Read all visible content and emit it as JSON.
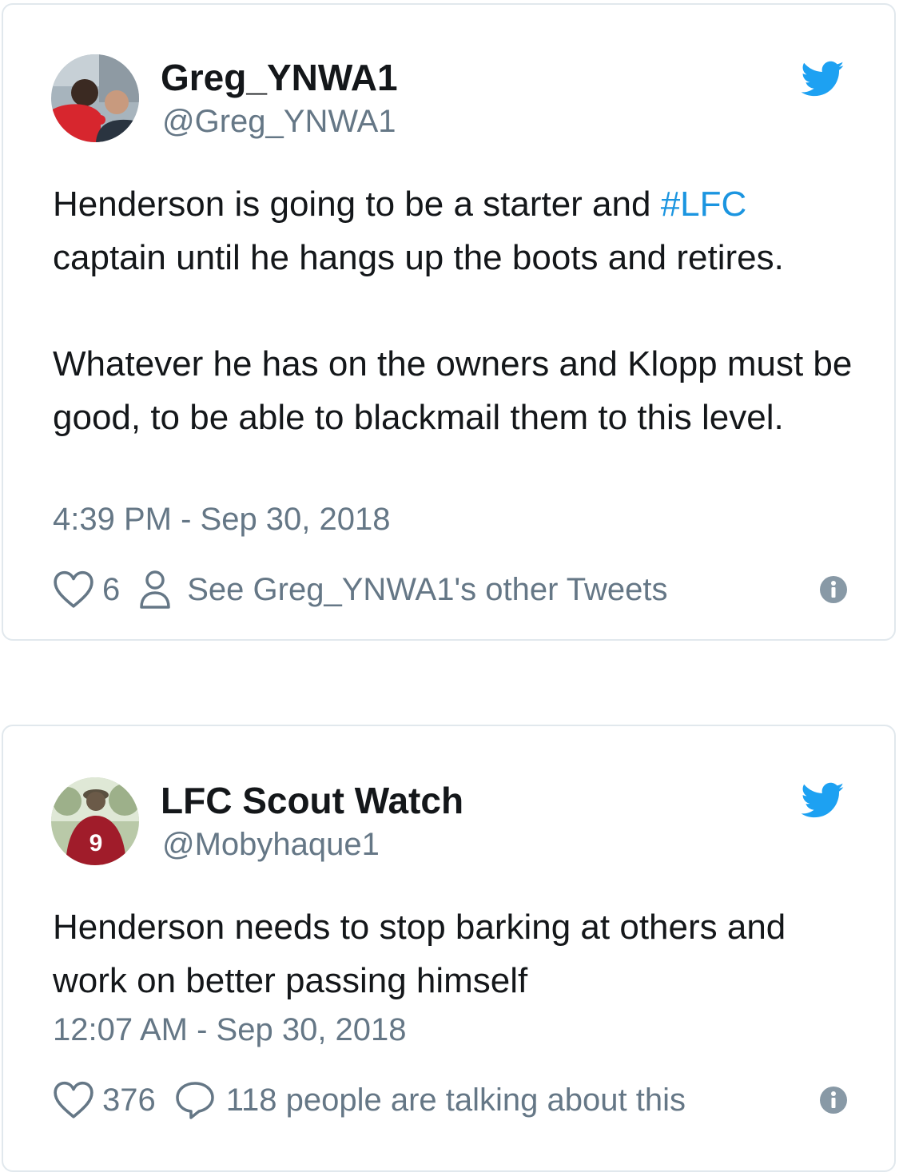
{
  "colors": {
    "accent": "#1b95e0",
    "muted": "#657786",
    "text": "#14171a",
    "border": "#e1e8ed"
  },
  "tweets": [
    {
      "display_name": "Greg_YNWA1",
      "handle": "@Greg_YNWA1",
      "text_before_hashtag": "Henderson is going to be a starter and ",
      "hashtag": "#LFC",
      "text_after_hashtag": " captain until he hangs up the boots and retires.",
      "paragraph2": "Whatever he has on the owners and Klopp must be good, to be able to blackmail them to this level.",
      "timestamp": "4:39 PM - Sep 30, 2018",
      "likes": "6",
      "secondary_action": "See Greg_YNWA1's other Tweets",
      "icons": [
        "twitter-bird-icon",
        "heart-icon",
        "person-icon",
        "info-icon"
      ]
    },
    {
      "display_name": "LFC Scout Watch",
      "handle": "@Mobyhaque1",
      "text": "Henderson needs to stop barking at others and work on better passing himself",
      "timestamp": "12:07 AM - Sep 30, 2018",
      "likes": "376",
      "secondary_action": "118 people are talking about this",
      "icons": [
        "twitter-bird-icon",
        "heart-icon",
        "speech-bubble-icon",
        "info-icon"
      ]
    }
  ]
}
